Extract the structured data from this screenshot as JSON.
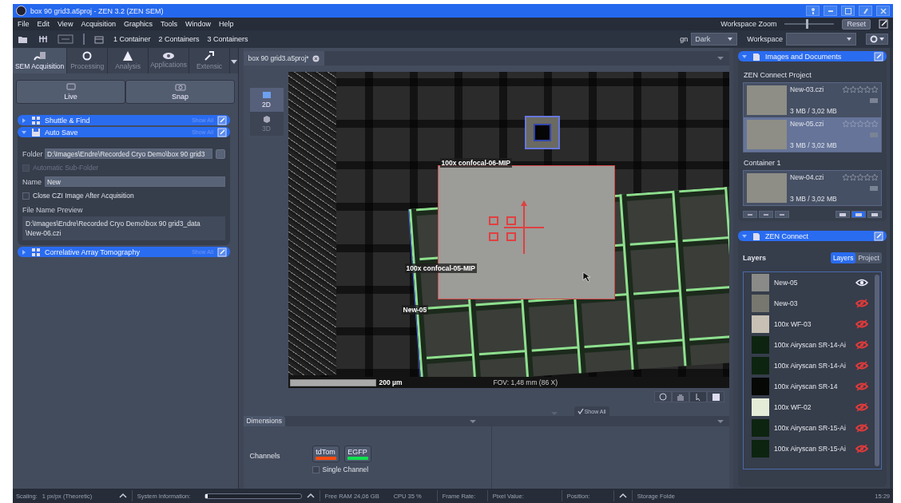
{
  "window": {
    "title": "box 90 grid3.a5proj - ZEN 3.2 (ZEN SEM)"
  },
  "menu": [
    "File",
    "Edit",
    "View",
    "Acquisition",
    "Graphics",
    "Tools",
    "Window",
    "Help"
  ],
  "workspace_zoom": {
    "label": "Workspace Zoom",
    "level": 0.45,
    "reset": "Reset"
  },
  "toolbar": {
    "containers": [
      "1 Container",
      "2 Containers",
      "3 Containers"
    ],
    "design_label": "gn",
    "design_value": "Dark",
    "workspace_label": "Workspace"
  },
  "left_tabs": [
    {
      "label": "SEM Acquisition",
      "selected": true
    },
    {
      "label": "Processing",
      "selected": false
    },
    {
      "label": "Analysis",
      "selected": false
    },
    {
      "label": "Applications",
      "selected": false
    },
    {
      "label": "Extensic",
      "selected": false
    }
  ],
  "acquire_buttons": [
    "Live",
    "Snap"
  ],
  "sections": [
    {
      "title": "Shuttle & Find",
      "show_all": "Show All",
      "expanded": false
    },
    {
      "title": "Auto Save",
      "show_all": "Show All",
      "expanded": true
    },
    {
      "title": "Correlative Array Tomography",
      "show_all": "Show All",
      "expanded": false
    }
  ],
  "auto_save": {
    "folder_label": "Folder",
    "folder_value": "D:\\Images\\Endre\\Recorded Cryo Demo\\box 90 grid3",
    "sub_folder": {
      "label": "Automatic Sub-Folder",
      "checked": false,
      "disabled": true
    },
    "name_label": "Name",
    "name_value": "New",
    "close_czi": {
      "label": "Close CZI Image After Acquisition",
      "checked": false
    },
    "preview_label": "File Name Preview",
    "preview_lines": [
      "D:\\Images\\Endre\\Recorded Cryo Demo\\box 90 grid3_data",
      "\\New-06.czi"
    ]
  },
  "document_tab": "box 90 grid3.a5proj*",
  "view_modes": [
    {
      "label": "2D",
      "selected": true
    },
    {
      "label": "3D",
      "selected": false
    }
  ],
  "image_labels": {
    "tile_top": "100x confocal-06-MIP",
    "tile_left": "100x confocal-05-MIP",
    "new": "New-05",
    "scale": "200 µm",
    "fov": "FOV: 1,48 mm (86 X)"
  },
  "show_all_tab": "Show All",
  "dimensions": {
    "tab": "Dimensions",
    "channels_label": "Channels",
    "channels": [
      {
        "name": "tdTom",
        "color": "#ff4a10"
      },
      {
        "name": "EGFP",
        "color": "#10e050"
      }
    ],
    "single_channel": {
      "label": "Single Channel",
      "checked": false
    }
  },
  "images_documents": {
    "title": "Images and Documents",
    "project_label": "ZEN Connect Project",
    "project_items": [
      {
        "name": "New-03.czi",
        "size": "3 MB / 3,02 MB",
        "stars": 0,
        "selected": false
      },
      {
        "name": "New-05.czi",
        "size": "3 MB / 3,02 MB",
        "stars": 0,
        "selected": true
      }
    ],
    "container_label": "Container 1",
    "container_items": [
      {
        "name": "New-04.czi",
        "size": "3 MB / 3,02 MB",
        "stars": 0,
        "selected": false
      }
    ]
  },
  "zen_connect": {
    "title": "ZEN Connect",
    "layers_label": "Layers",
    "toggle": [
      {
        "label": "Layers",
        "selected": true
      },
      {
        "label": "Project",
        "selected": false
      }
    ],
    "layers": [
      {
        "name": "New-05",
        "visible": true
      },
      {
        "name": "New-03",
        "visible": false
      },
      {
        "name": "100x WF-03",
        "visible": false
      },
      {
        "name": "100x Airyscan SR-14-Ai",
        "visible": false
      },
      {
        "name": "100x Airyscan SR-14-Ai",
        "visible": false
      },
      {
        "name": "100x Airyscan SR-14",
        "visible": false
      },
      {
        "name": "100x WF-02",
        "visible": false
      },
      {
        "name": "100x Airyscan SR-15-Ai",
        "visible": false
      },
      {
        "name": "100x Airyscan SR-15-Ai",
        "visible": false
      }
    ]
  },
  "status_bar": {
    "scaling_label": "Scaling:",
    "scaling_value": "1 px/px (Theoretic)",
    "system_label": "System Information:",
    "progress": {
      "level": 0.03
    },
    "ram": "Free RAM 24,06 GB",
    "cpu": "CPU 35 %",
    "frame_rate": "Frame Rate:",
    "pixel_value": "Pixel Value:",
    "position": "Position:",
    "storage": "Storage Folde",
    "time": "15:29"
  }
}
